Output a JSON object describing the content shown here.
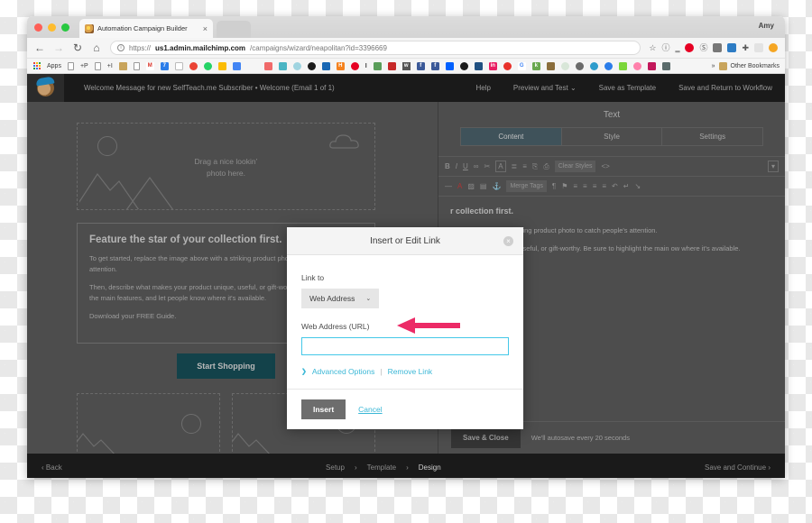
{
  "browser": {
    "tab": {
      "title": "Automation Campaign Builder",
      "close": "×",
      "favicon": "mailchimp-icon"
    },
    "profile": "Amy",
    "nav": {
      "back": "←",
      "forward": "→",
      "reload": "↻",
      "home": "⌂"
    },
    "url": {
      "scheme": "https://",
      "host": "us1.admin.mailchimp.com",
      "path": "/campaigns/wizard/neapolitan?id=3396669",
      "info_icon": "info-icon"
    },
    "omni_icons": [
      "star-icon",
      "info-circle-icon",
      "lastpass-icon",
      "pinterest-icon",
      "adblock-icon",
      "pocket-icon",
      "evernote-icon",
      "add-icon",
      "window-icon",
      "orange-dot-icon"
    ],
    "bookmarks": {
      "apps_label": "Apps",
      "items": [
        "+P",
        "+I",
        "folder-icon",
        "doc-icon",
        "gmail-icon",
        "calendar-icon",
        "checkbox-icon",
        "chrome-icon",
        "whatsapp-icon",
        "drive-icon",
        "keep-icon",
        "asana-icon",
        "box-icon",
        "cloud-icon",
        "disc-icon",
        "trello-icon",
        "hootsuite-icon",
        "pinterest2-icon",
        "I",
        "instagram-icon",
        "flash-icon",
        "script-icon",
        "facebook-icon",
        "facebook2-icon",
        "dropbox-icon",
        "github-icon",
        "bitbucket-icon",
        "linkedin-icon",
        "hubspot-icon",
        "google-icon",
        "kajabi-icon",
        "briefcase-icon",
        "circle-icon",
        "wordpress-icon",
        "gear-icon",
        "refresh-icon",
        "buffer-icon",
        "loop-icon",
        "red-icon",
        "layers-icon"
      ],
      "overflow": "»",
      "other_label": "Other Bookmarks"
    }
  },
  "app": {
    "campaign_title": "Welcome Message for new SelfTeach.me Subscriber • Welcome (Email 1 of 1)",
    "top_actions": [
      "Help",
      "Preview and Test",
      "Save as Template",
      "Save and Return to Workflow"
    ],
    "preview_caret": "⌄",
    "email": {
      "placeholder_text_line1": "Drag a nice lookin’",
      "placeholder_text_line2": "photo here.",
      "heading": "Feature the star of your collection first.",
      "para1": "To get started, replace the image above with a striking product photo to catch people's attention.",
      "para2": "Then, describe what makes your product unique, useful, or gift-worthy. Be sure to highlight the main features, and let people know where it's available.",
      "para3": "Download your FREE Guide.",
      "cta": "Start Shopping"
    },
    "panel": {
      "title": "Text",
      "tabs": [
        {
          "label": "Content",
          "active": true
        },
        {
          "label": "Style",
          "active": false
        },
        {
          "label": "Settings",
          "active": false
        }
      ],
      "toolbar_row1": [
        "B",
        "I",
        "U",
        "∞",
        "✂",
        "A",
        "≣",
        "≡",
        "⎘",
        "⎙",
        "Clear Styles",
        "<>"
      ],
      "toolbar_row2": [
        "—",
        "A",
        "▨",
        "▤",
        "⚓",
        "Merge Tags",
        "¶",
        "⚑",
        "≡",
        "≡",
        "≡",
        "≡",
        "↶",
        "↵",
        "↘"
      ],
      "collapse_icon": "▾",
      "editor": {
        "heading_tail": "r collection first.",
        "para1": "image above with a striking product photo to catch people's attention.",
        "para2": "s your product unique, useful, or gift-worthy. Be sure to highlight the main ow where it's available.",
        "para3": "e."
      },
      "save_close": "Save & Close",
      "autosave": "We'll autosave every 20 seconds"
    },
    "footer": {
      "back": "Back",
      "back_chevron": "‹",
      "breadcrumb": [
        "Setup",
        "Template",
        "Design"
      ],
      "breadcrumb_sep": "›",
      "continue": "Save and Continue",
      "continue_chevron": "›"
    }
  },
  "modal": {
    "title": "Insert or Edit Link",
    "close_icon": "×",
    "link_to_label": "Link to",
    "link_to_value": "Web Address",
    "caret": "⌄",
    "url_label": "Web Address (URL)",
    "url_value": "",
    "url_placeholder": "",
    "advanced_options": "Advanced Options",
    "advanced_chevron": "❯",
    "separator": "|",
    "remove_link": "Remove Link",
    "insert": "Insert",
    "cancel": "Cancel"
  },
  "annotation": {
    "arrow": "left-pointing-arrow",
    "color": "#ec2a66"
  },
  "colors": {
    "accent_teal": "#3bb7d6",
    "cta_teal": "#13424a",
    "arrow_pink": "#ec2a66",
    "overlay_gray": "#4d4d4d",
    "input_border": "#44c8e8"
  }
}
